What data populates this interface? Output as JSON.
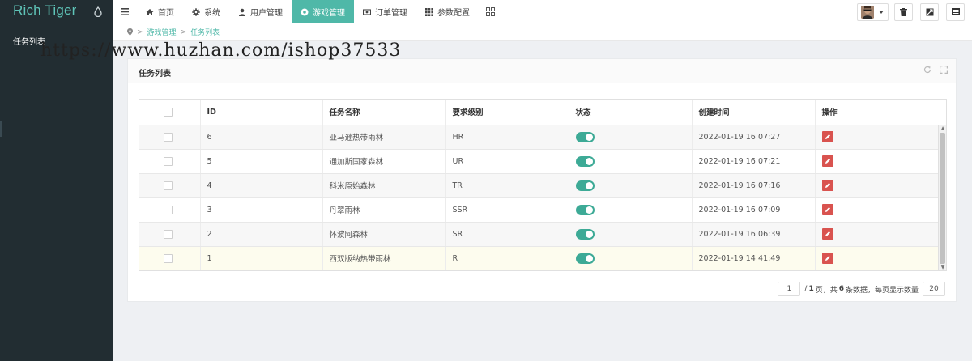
{
  "app": {
    "logo": "Rich Tiger"
  },
  "nav": {
    "items": [
      {
        "label": "首页",
        "icon": "home-icon"
      },
      {
        "label": "系统",
        "icon": "gear-icon"
      },
      {
        "label": "用户管理",
        "icon": "user-icon"
      },
      {
        "label": "游戏管理",
        "icon": "game-icon",
        "active": true
      },
      {
        "label": "订单管理",
        "icon": "money-icon"
      },
      {
        "label": "参数配置",
        "icon": "grid-icon"
      }
    ]
  },
  "sidebar": {
    "items": [
      {
        "label": "任务列表"
      }
    ]
  },
  "breadcrumb": {
    "items": [
      "游戏管理",
      "任务列表"
    ]
  },
  "watermark": "https://www.huzhan.com/ishop37533",
  "panel": {
    "title": "任务列表"
  },
  "table": {
    "columns": [
      "ID",
      "任务名称",
      "要求级别",
      "状态",
      "创建时间",
      "操作"
    ],
    "rows": [
      {
        "id": "6",
        "name": "亚马逊热带雨林",
        "level": "HR",
        "status": true,
        "created": "2022-01-19 16:07:27"
      },
      {
        "id": "5",
        "name": "通加斯国家森林",
        "level": "UR",
        "status": true,
        "created": "2022-01-19 16:07:21"
      },
      {
        "id": "4",
        "name": "科米原始森林",
        "level": "TR",
        "status": true,
        "created": "2022-01-19 16:07:16"
      },
      {
        "id": "3",
        "name": "丹翠雨林",
        "level": "SSR",
        "status": true,
        "created": "2022-01-19 16:07:09"
      },
      {
        "id": "2",
        "name": "怀波阿森林",
        "level": "SR",
        "status": true,
        "created": "2022-01-19 16:06:39"
      },
      {
        "id": "1",
        "name": "西双版纳热带雨林",
        "level": "R",
        "status": true,
        "created": "2022-01-19 14:41:49"
      }
    ]
  },
  "pagination": {
    "current_page": "1",
    "sep": "/",
    "total_pages": "1",
    "unit_page": "页，共",
    "total_records": "6",
    "unit_records": "条数据，每页显示数量",
    "page_size": "20"
  },
  "colors": {
    "accent": "#4fb8a8",
    "sidebar": "#222d32",
    "switch_on": "#3daa96",
    "edit": "#d9534f"
  }
}
